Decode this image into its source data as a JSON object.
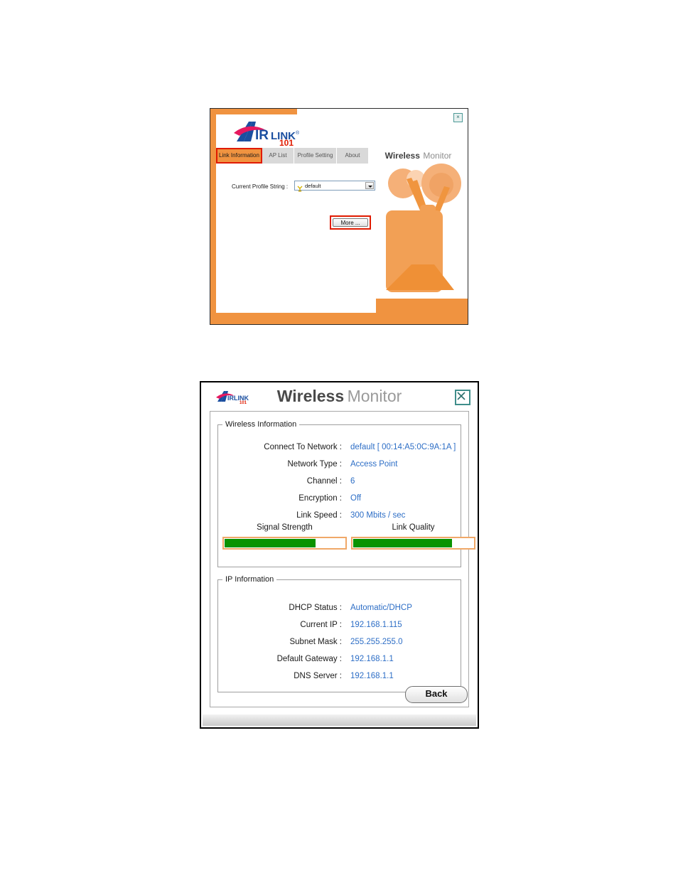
{
  "brand": {
    "name": "AIRLINK",
    "suffix": "101",
    "title_bold": "Wireless",
    "title_light": "Monitor"
  },
  "dialog_one": {
    "close_label": "×",
    "tabs": [
      {
        "label": "Link Information",
        "active": true
      },
      {
        "label": "AP List",
        "active": false
      },
      {
        "label": "Profile Setting",
        "active": false
      },
      {
        "label": "About",
        "active": false
      }
    ],
    "profile": {
      "label": "Current Profile String :",
      "value": "default",
      "icon": "antenna-icon",
      "options": [
        "default"
      ]
    },
    "more_button": "More ...",
    "artwork": "wireless-router-illustration",
    "accent_color": "#f09340",
    "highlight_color": "#e01b00"
  },
  "dialog_two": {
    "close_label": "close-icon",
    "wireless_group": {
      "legend": "Wireless Information",
      "fields": [
        {
          "label": "Connect To Network :",
          "value": "default [ 00:14:A5:0C:9A:1A ]"
        },
        {
          "label": "Network Type :",
          "value": "Access Point"
        },
        {
          "label": "Channel :",
          "value": "6"
        },
        {
          "label": "Encryption :",
          "value": "Off"
        },
        {
          "label": "Link Speed :",
          "value": "300 Mbits / sec"
        }
      ],
      "meters": [
        {
          "caption": "Signal Strength",
          "percent": 76
        },
        {
          "caption": "Link Quality",
          "percent": 82
        }
      ]
    },
    "ip_group": {
      "legend": "IP Information",
      "fields": [
        {
          "label": "DHCP Status :",
          "value": "Automatic/DHCP"
        },
        {
          "label": "Current IP :",
          "value": "192.168.1.115"
        },
        {
          "label": "Subnet Mask :",
          "value": "255.255.255.0"
        },
        {
          "label": "Default Gateway :",
          "value": "192.168.1.1"
        },
        {
          "label": "DNS Server :",
          "value": "192.168.1.1"
        }
      ]
    },
    "back_button": "Back",
    "value_color": "#2d6ec6",
    "meter_fill_color": "#0a9300",
    "meter_border_color": "#f0a868"
  }
}
